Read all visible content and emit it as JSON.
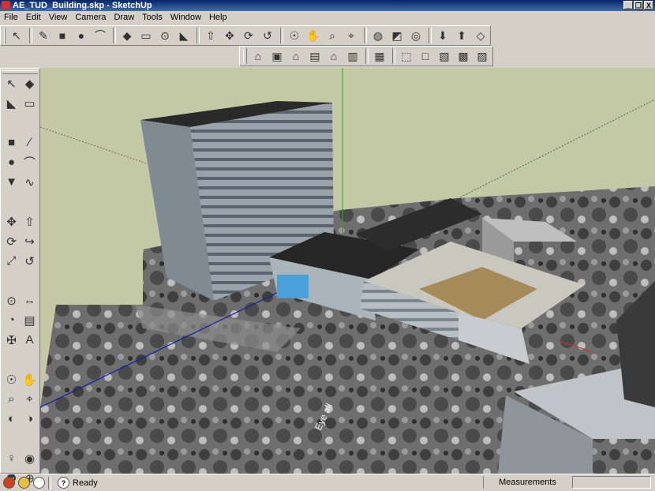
{
  "window": {
    "title": "AE_TUD_Building.skp - SketchUp",
    "controls": {
      "minimize": "_",
      "restore": "❐",
      "close": "X"
    }
  },
  "menu": [
    "File",
    "Edit",
    "View",
    "Camera",
    "Draw",
    "Tools",
    "Window",
    "Help"
  ],
  "toolbar_main": [
    {
      "name": "select-icon",
      "glyph": "↖"
    },
    {
      "sep": true
    },
    {
      "name": "pencil-icon",
      "glyph": "✎"
    },
    {
      "name": "rectangle-icon",
      "glyph": "■"
    },
    {
      "name": "circle-icon",
      "glyph": "●"
    },
    {
      "name": "arc-icon",
      "glyph": "⌒"
    },
    {
      "sep": true
    },
    {
      "name": "make-component-icon",
      "glyph": "◆"
    },
    {
      "name": "eraser-icon",
      "glyph": "▭"
    },
    {
      "name": "tape-measure-icon",
      "glyph": "⊙"
    },
    {
      "name": "paint-bucket-icon",
      "glyph": "◣"
    },
    {
      "sep": true
    },
    {
      "name": "push-pull-icon",
      "glyph": "⇧"
    },
    {
      "name": "move-icon",
      "glyph": "✥"
    },
    {
      "name": "rotate-icon",
      "glyph": "⟳"
    },
    {
      "name": "offset-icon",
      "glyph": "↺"
    },
    {
      "sep": true
    },
    {
      "name": "orbit-icon",
      "glyph": "☉"
    },
    {
      "name": "pan-icon",
      "glyph": "✋"
    },
    {
      "name": "zoom-icon",
      "glyph": "⌕"
    },
    {
      "name": "zoom-extents-icon",
      "glyph": "⌖"
    },
    {
      "sep": true
    },
    {
      "name": "google-earth-icon",
      "glyph": "◍"
    },
    {
      "name": "toggle-terrain-icon",
      "glyph": "◩"
    },
    {
      "name": "place-model-icon",
      "glyph": "◎"
    },
    {
      "sep": true
    },
    {
      "name": "get-models-icon",
      "glyph": "⬇"
    },
    {
      "name": "share-model-icon",
      "glyph": "⬆"
    },
    {
      "name": "share-component-icon",
      "glyph": "◇"
    }
  ],
  "toolbar_views": [
    {
      "name": "iso-view-icon",
      "glyph": "⌂"
    },
    {
      "name": "top-view-icon",
      "glyph": "▣"
    },
    {
      "name": "front-view-icon",
      "glyph": "⌂"
    },
    {
      "name": "right-view-icon",
      "glyph": "▤"
    },
    {
      "name": "back-view-icon",
      "glyph": "⌂"
    },
    {
      "name": "left-view-icon",
      "glyph": "▥"
    },
    {
      "sep": true
    },
    {
      "name": "xray-icon",
      "glyph": "▦"
    },
    {
      "sep": true
    },
    {
      "name": "wireframe-icon",
      "glyph": "⬚"
    },
    {
      "name": "hidden-line-icon",
      "glyph": "□"
    },
    {
      "name": "shaded-icon",
      "glyph": "▧"
    },
    {
      "name": "shaded-textures-icon",
      "glyph": "▩"
    },
    {
      "name": "monochrome-icon",
      "glyph": "▨"
    }
  ],
  "left_tools": [
    {
      "name": "select-icon",
      "glyph": "↖"
    },
    {
      "name": "make-component-icon",
      "glyph": "◆"
    },
    {
      "name": "paint-bucket-icon",
      "glyph": "◣"
    },
    {
      "name": "eraser-icon",
      "glyph": "▭"
    },
    {
      "gap": true
    },
    {
      "name": "rectangle-icon",
      "glyph": "■"
    },
    {
      "name": "line-icon",
      "glyph": "∕"
    },
    {
      "name": "circle-icon",
      "glyph": "●"
    },
    {
      "name": "arc-icon",
      "glyph": "⌒"
    },
    {
      "name": "polygon-icon",
      "glyph": "▼"
    },
    {
      "name": "freehand-icon",
      "glyph": "∿"
    },
    {
      "gap": true
    },
    {
      "name": "move-icon",
      "glyph": "✥"
    },
    {
      "name": "push-pull-icon",
      "glyph": "⇧"
    },
    {
      "name": "rotate-icon",
      "glyph": "⟳"
    },
    {
      "name": "follow-me-icon",
      "glyph": "↪"
    },
    {
      "name": "scale-icon",
      "glyph": "⤢"
    },
    {
      "name": "offset-icon",
      "glyph": "↺"
    },
    {
      "gap": true
    },
    {
      "name": "tape-measure-icon",
      "glyph": "⊙"
    },
    {
      "name": "dimension-icon",
      "glyph": "↔"
    },
    {
      "name": "protractor-icon",
      "glyph": "◔"
    },
    {
      "name": "text-icon",
      "glyph": "▤"
    },
    {
      "name": "axes-icon",
      "glyph": "✠"
    },
    {
      "name": "3d-text-icon",
      "glyph": "A"
    },
    {
      "gap": true
    },
    {
      "name": "orbit-icon",
      "glyph": "☉"
    },
    {
      "name": "pan-icon",
      "glyph": "✋"
    },
    {
      "name": "zoom-icon",
      "glyph": "⌕"
    },
    {
      "name": "zoom-window-icon",
      "glyph": "⌖"
    },
    {
      "name": "previous-view-icon",
      "glyph": "◐"
    },
    {
      "name": "next-view-icon",
      "glyph": "◑"
    },
    {
      "gap": true
    },
    {
      "name": "position-camera-icon",
      "glyph": "♀"
    },
    {
      "name": "look-around-icon",
      "glyph": "◉"
    },
    {
      "name": "walk-icon",
      "glyph": "⚉"
    },
    {
      "name": "section-plane-icon",
      "glyph": "⊕"
    }
  ],
  "viewport": {
    "ground_text": "Eye all"
  },
  "status": {
    "text": "Ready",
    "measurements_label": "Measurements",
    "measurements_value": ""
  }
}
